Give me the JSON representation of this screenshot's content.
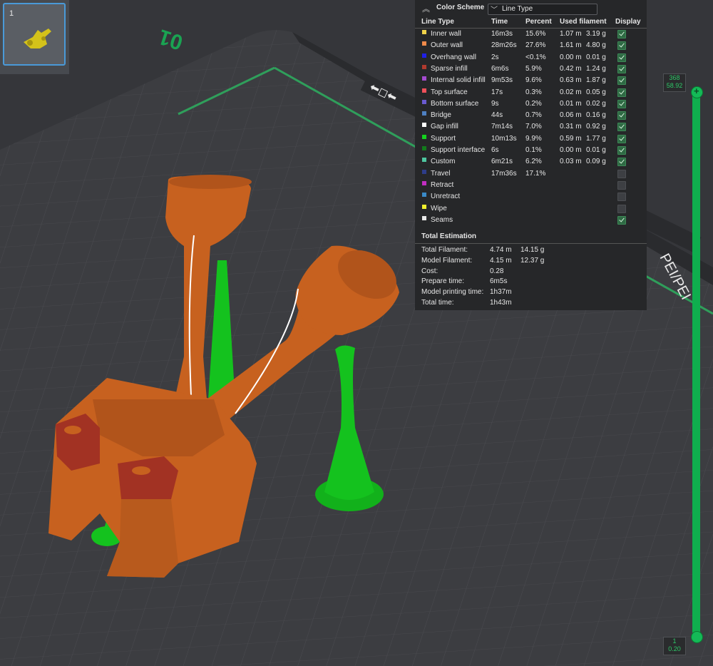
{
  "plate": {
    "number": "1"
  },
  "bed": {
    "plate_number": "01",
    "label_text": "PEI/PET",
    "label_text2": "PEI/PEI"
  },
  "legend": {
    "title": "Color Scheme",
    "scheme_value": "Line Type",
    "headers": {
      "line_type": "Line Type",
      "time": "Time",
      "percent": "Percent",
      "used_filament": "Used filament",
      "display": "Display"
    },
    "rows": [
      {
        "label": "Inner wall",
        "color": "#f0d34a",
        "time": "16m3s",
        "percent": "15.6%",
        "len": "1.07 m",
        "weight": "3.19 g",
        "display": true
      },
      {
        "label": "Outer wall",
        "color": "#f08a4a",
        "time": "28m26s",
        "percent": "27.6%",
        "len": "1.61 m",
        "weight": "4.80 g",
        "display": true
      },
      {
        "label": "Overhang wall",
        "color": "#1f1fe8",
        "time": "2s",
        "percent": "<0.1%",
        "len": "0.00 m",
        "weight": "0.01 g",
        "display": true
      },
      {
        "label": "Sparse infill",
        "color": "#b03a2e",
        "time": "6m6s",
        "percent": "5.9%",
        "len": "0.42 m",
        "weight": "1.24 g",
        "display": true
      },
      {
        "label": "Internal solid infill",
        "color": "#a44bd0",
        "time": "9m53s",
        "percent": "9.6%",
        "len": "0.63 m",
        "weight": "1.87 g",
        "display": true
      },
      {
        "label": "Top surface",
        "color": "#f0505a",
        "time": "17s",
        "percent": "0.3%",
        "len": "0.02 m",
        "weight": "0.05 g",
        "display": true
      },
      {
        "label": "Bottom surface",
        "color": "#6a5ad0",
        "time": "9s",
        "percent": "0.2%",
        "len": "0.01 m",
        "weight": "0.02 g",
        "display": true
      },
      {
        "label": "Bridge",
        "color": "#4e80c2",
        "time": "44s",
        "percent": "0.7%",
        "len": "0.06 m",
        "weight": "0.16 g",
        "display": true
      },
      {
        "label": "Gap infill",
        "color": "#ffffff",
        "time": "7m14s",
        "percent": "7.0%",
        "len": "0.31 m",
        "weight": "0.92 g",
        "display": true
      },
      {
        "label": "Support",
        "color": "#14d21e",
        "time": "10m13s",
        "percent": "9.9%",
        "len": "0.59 m",
        "weight": "1.77 g",
        "display": true
      },
      {
        "label": "Support interface",
        "color": "#127a1c",
        "time": "6s",
        "percent": "0.1%",
        "len": "0.00 m",
        "weight": "0.01 g",
        "display": true
      },
      {
        "label": "Custom",
        "color": "#4ec6a0",
        "time": "6m21s",
        "percent": "6.2%",
        "len": "0.03 m",
        "weight": "0.09 g",
        "display": true
      },
      {
        "label": "Travel",
        "color": "#2e3d8a",
        "time": "17m36s",
        "percent": "17.1%",
        "len": "",
        "weight": "",
        "display": false
      },
      {
        "label": "Retract",
        "color": "#c22ec2",
        "time": "",
        "percent": "",
        "len": "",
        "weight": "",
        "display": false
      },
      {
        "label": "Unretract",
        "color": "#3a8ac8",
        "time": "",
        "percent": "",
        "len": "",
        "weight": "",
        "display": false
      },
      {
        "label": "Wipe",
        "color": "#f0f02e",
        "time": "",
        "percent": "",
        "len": "",
        "weight": "",
        "display": false
      },
      {
        "label": "Seams",
        "color": "#e8e8e8",
        "time": "",
        "percent": "",
        "len": "",
        "weight": "",
        "display": true
      }
    ],
    "totals_title": "Total Estimation",
    "totals": [
      {
        "label": "Total Filament:",
        "v1": "4.74 m",
        "v2": "14.15 g"
      },
      {
        "label": "Model Filament:",
        "v1": "4.15 m",
        "v2": "12.37 g"
      },
      {
        "label": "Cost:",
        "v1": "0.28",
        "v2": ""
      },
      {
        "label": "Prepare time:",
        "v1": "6m5s",
        "v2": ""
      },
      {
        "label": "Model printing time:",
        "v1": "1h37m",
        "v2": ""
      },
      {
        "label": "Total time:",
        "v1": "1h43m",
        "v2": ""
      }
    ]
  },
  "layer_slider": {
    "top_layer": "368",
    "top_height": "58.92",
    "bottom_layer": "1",
    "bottom_height": "0.20"
  },
  "colors": {
    "model": "#c7611f",
    "support": "#14c21e",
    "bed": "#3c3d41",
    "accent": "#2dc767"
  }
}
